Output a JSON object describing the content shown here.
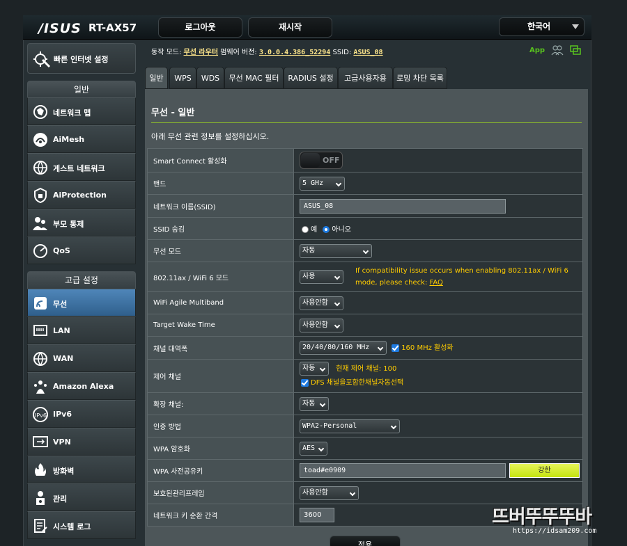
{
  "header": {
    "logo": "/ISUS",
    "model": "RT-AX57",
    "logout": "로그아웃",
    "reboot": "재시작",
    "language": "한국어"
  },
  "status": {
    "mode_label": "동작 모드:",
    "mode_value": "무선 라우터",
    "fw_label": "펌웨어 버전:",
    "fw_value": "3.0.0.4.386_52294",
    "ssid_label": "SSID:",
    "ssid_value": "ASUS_08",
    "app": "App"
  },
  "sidebar": {
    "quick_setup": "빠른 인터넷 설정",
    "general_head": "일반",
    "general_items": [
      {
        "label": "네트워크 맵",
        "icon": "network-map-icon"
      },
      {
        "label": "AiMesh",
        "icon": "aimesh-icon"
      },
      {
        "label": "게스트 네트워크",
        "icon": "guest-network-icon"
      },
      {
        "label": "AiProtection",
        "icon": "aiprotection-icon"
      },
      {
        "label": "부모 통제",
        "icon": "parental-control-icon"
      },
      {
        "label": "QoS",
        "icon": "qos-icon"
      }
    ],
    "advanced_head": "고급 설정",
    "advanced_items": [
      {
        "label": "무선",
        "icon": "wireless-icon"
      },
      {
        "label": "LAN",
        "icon": "lan-icon"
      },
      {
        "label": "WAN",
        "icon": "wan-icon"
      },
      {
        "label": "Amazon Alexa",
        "icon": "alexa-icon"
      },
      {
        "label": "IPv6",
        "icon": "ipv6-icon"
      },
      {
        "label": "VPN",
        "icon": "vpn-icon"
      },
      {
        "label": "방화벽",
        "icon": "firewall-icon"
      },
      {
        "label": "관리",
        "icon": "admin-icon"
      },
      {
        "label": "시스템 로그",
        "icon": "system-log-icon"
      }
    ]
  },
  "tabs": [
    "일반",
    "WPS",
    "WDS",
    "무선 MAC 필터",
    "RADIUS 설정",
    "고급사용자용",
    "로밍 차단 목록"
  ],
  "main": {
    "title": "무선 - 일반",
    "description": "아래 무선 관련 정보를 설정하십시오."
  },
  "settings": {
    "smart_connect": {
      "label": "Smart Connect 활성화",
      "value": "OFF"
    },
    "band": {
      "label": "밴드",
      "value": "5 GHz"
    },
    "ssid": {
      "label": "네트워크 이름(SSID)",
      "value": "ASUS_08"
    },
    "hide_ssid": {
      "label": "SSID 숨김",
      "yes": "예",
      "no": "아니오"
    },
    "wireless_mode": {
      "label": "무선 모드",
      "value": "자동"
    },
    "wifi6": {
      "label": "802.11ax / WiFi 6 모드",
      "value": "사용",
      "note": "If compatibility issue occurs when enabling 802.11ax / WiFi 6 mode, please check:",
      "faq": "FAQ"
    },
    "agile": {
      "label": "WiFi Agile Multiband",
      "value": "사용안함"
    },
    "twt": {
      "label": "Target Wake Time",
      "value": "사용안함"
    },
    "bandwidth": {
      "label": "채널 대역폭",
      "value": "20/40/80/160 MHz",
      "check": "160 MHz 활성화"
    },
    "control_channel": {
      "label": "제어 채널",
      "value": "자동",
      "current": "현재 제어 채널: 100",
      "dfs": "DFS 채널을포함한채널자동선택"
    },
    "ext_channel": {
      "label": "확장 채널:",
      "value": "자동"
    },
    "auth": {
      "label": "인증 방법",
      "value": "WPA2-Personal"
    },
    "encryption": {
      "label": "WPA 암호화",
      "value": "AES"
    },
    "psk": {
      "label": "WPA 사전공유키",
      "value": "toad#e0909",
      "strength": "강한"
    },
    "pmf": {
      "label": "보호된관리프레임",
      "value": "사용안함"
    },
    "rotation": {
      "label": "네트워크 키 순환 간격",
      "value": "3600"
    }
  },
  "apply": "적용",
  "watermark": {
    "title": "뜨버뚜뚜뚜바",
    "url": "https://idsam209.com"
  },
  "colors": {
    "accent_green": "#8fbf2a",
    "warning": "#ffcc00",
    "active_menu": "#3f73a4",
    "link": "#ffe78c"
  }
}
